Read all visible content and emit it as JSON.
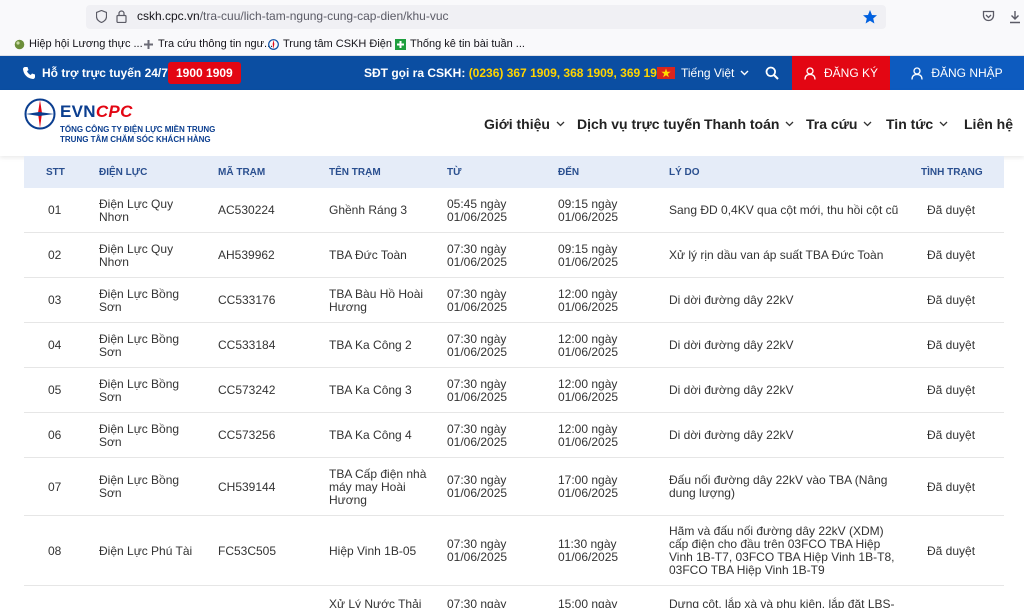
{
  "browser": {
    "url_host": "cskh.cpc.vn",
    "url_path": "/tra-cuu/lich-tam-ngung-cung-cap-dien/khu-vuc",
    "bookmarks": [
      {
        "label": "Hiệp hội Lương thực ..."
      },
      {
        "label": "Tra cứu thông tin ngư..."
      },
      {
        "label": "Trung tâm CSKH Điện ..."
      },
      {
        "label": "Thống kê tin bài tuần ..."
      }
    ]
  },
  "topbar": {
    "support_label": "Hỗ trợ trực tuyến 24/7:",
    "hotline": "1900 1909",
    "cskh_label": "SĐT gọi ra CSKH:",
    "cskh_numbers": "(0236) 367 1909, 368 1909, 369 1909",
    "language": "Tiếng Việt",
    "register_label": "ĐĂNG KÝ",
    "login_label": "ĐĂNG NHẬP"
  },
  "header": {
    "logo_evn": "EVN",
    "logo_cpc": "CPC",
    "logo_sub1": "TỔNG CÔNG TY ĐIỆN LỰC MIỀN TRUNG",
    "logo_sub2": "TRUNG TÂM CHĂM SÓC KHÁCH HÀNG",
    "nav": [
      {
        "label": "Giới thiệu",
        "dropdown": true
      },
      {
        "label": "Dịch vụ trực tuyến",
        "dropdown": false
      },
      {
        "label": "Thanh toán",
        "dropdown": true
      },
      {
        "label": "Tra cứu",
        "dropdown": true
      },
      {
        "label": "Tin tức",
        "dropdown": true
      },
      {
        "label": "Liên hệ",
        "dropdown": false
      }
    ]
  },
  "table": {
    "columns": [
      "STT",
      "ĐIỆN LỰC",
      "MÃ TRẠM",
      "TÊN TRẠM",
      "TỪ",
      "ĐẾN",
      "LÝ DO",
      "TÌNH TRẠNG"
    ],
    "rows": [
      {
        "stt": "01",
        "dienluc": [
          "Điện Lực Quy",
          "Nhơn"
        ],
        "ma": "AC530224",
        "ten": [
          "Ghềnh Ráng 3"
        ],
        "tu": [
          "05:45 ngày",
          "01/06/2025"
        ],
        "den": [
          "09:15 ngày",
          "01/06/2025"
        ],
        "lydo": [
          "Sang ĐD 0,4KV qua cột mới, thu hồi cột cũ"
        ],
        "tinhtrang": "Đã duyệt"
      },
      {
        "stt": "02",
        "dienluc": [
          "Điện Lực Quy",
          "Nhơn"
        ],
        "ma": "AH539962",
        "ten": [
          "TBA Đức Toàn"
        ],
        "tu": [
          "07:30 ngày",
          "01/06/2025"
        ],
        "den": [
          "09:15 ngày",
          "01/06/2025"
        ],
        "lydo": [
          "Xử lý rịn dầu van áp suất TBA Đức Toàn"
        ],
        "tinhtrang": "Đã duyệt"
      },
      {
        "stt": "03",
        "dienluc": [
          "Điện Lực Bồng",
          "Sơn"
        ],
        "ma": "CC533176",
        "ten": [
          "TBA Bàu Hồ Hoài",
          "Hương"
        ],
        "tu": [
          "07:30 ngày",
          "01/06/2025"
        ],
        "den": [
          "12:00 ngày",
          "01/06/2025"
        ],
        "lydo": [
          "Di dời đường dây 22kV"
        ],
        "tinhtrang": "Đã duyệt"
      },
      {
        "stt": "04",
        "dienluc": [
          "Điện Lực Bồng",
          "Sơn"
        ],
        "ma": "CC533184",
        "ten": [
          "TBA Ka Công 2"
        ],
        "tu": [
          "07:30 ngày",
          "01/06/2025"
        ],
        "den": [
          "12:00 ngày",
          "01/06/2025"
        ],
        "lydo": [
          "Di dời đường dây 22kV"
        ],
        "tinhtrang": "Đã duyệt"
      },
      {
        "stt": "05",
        "dienluc": [
          "Điện Lực Bồng",
          "Sơn"
        ],
        "ma": "CC573242",
        "ten": [
          "TBA Ka Công 3"
        ],
        "tu": [
          "07:30 ngày",
          "01/06/2025"
        ],
        "den": [
          "12:00 ngày",
          "01/06/2025"
        ],
        "lydo": [
          "Di dời đường dây 22kV"
        ],
        "tinhtrang": "Đã duyệt"
      },
      {
        "stt": "06",
        "dienluc": [
          "Điện Lực Bồng",
          "Sơn"
        ],
        "ma": "CC573256",
        "ten": [
          "TBA Ka Công 4"
        ],
        "tu": [
          "07:30 ngày",
          "01/06/2025"
        ],
        "den": [
          "12:00 ngày",
          "01/06/2025"
        ],
        "lydo": [
          "Di dời đường dây 22kV"
        ],
        "tinhtrang": "Đã duyệt"
      },
      {
        "stt": "07",
        "dienluc": [
          "Điện Lực Bồng",
          "Sơn"
        ],
        "ma": "CH539144",
        "ten": [
          "TBA Cấp điện nhà",
          "máy may Hoài",
          "Hương"
        ],
        "tu": [
          "07:30 ngày",
          "01/06/2025"
        ],
        "den": [
          "17:00 ngày",
          "01/06/2025"
        ],
        "lydo": [
          "Đấu nối đường dây 22kV vào TBA (Nâng",
          "dung lượng)"
        ],
        "tinhtrang": "Đã duyệt"
      },
      {
        "stt": "08",
        "dienluc": [
          "Điện Lực Phú Tài"
        ],
        "ma": "FC53C505",
        "ten": [
          "Hiệp Vinh 1B-05"
        ],
        "tu": [
          "07:30 ngày",
          "01/06/2025"
        ],
        "den": [
          "11:30 ngày",
          "01/06/2025"
        ],
        "lydo": [
          "Hãm và đấu nối đường dây 22kV (XDM)",
          "cấp điện cho đầu trên 03FCO TBA Hiệp",
          "Vinh 1B-T7, 03FCO TBA Hiệp Vinh 1B-T8,",
          "03FCO TBA Hiệp Vinh 1B-T9"
        ],
        "tinhtrang": "Đã duyệt"
      },
      {
        "stt": "",
        "dienluc": [
          ""
        ],
        "ma": "",
        "ten": [
          "Xử Lý Nước Thải"
        ],
        "tu": [
          "07:30 ngày"
        ],
        "den": [
          "15:00 ngày"
        ],
        "lydo": [
          "Dựng cột, lắp xà và phụ kiện, lắp đặt LBS-"
        ],
        "tinhtrang": ""
      }
    ]
  },
  "colors": {
    "brand_blue": "#0b4ea2",
    "hotline_red": "#e30613",
    "highlight_yellow": "#ffd400",
    "table_header_bg": "#e5ecf8"
  }
}
